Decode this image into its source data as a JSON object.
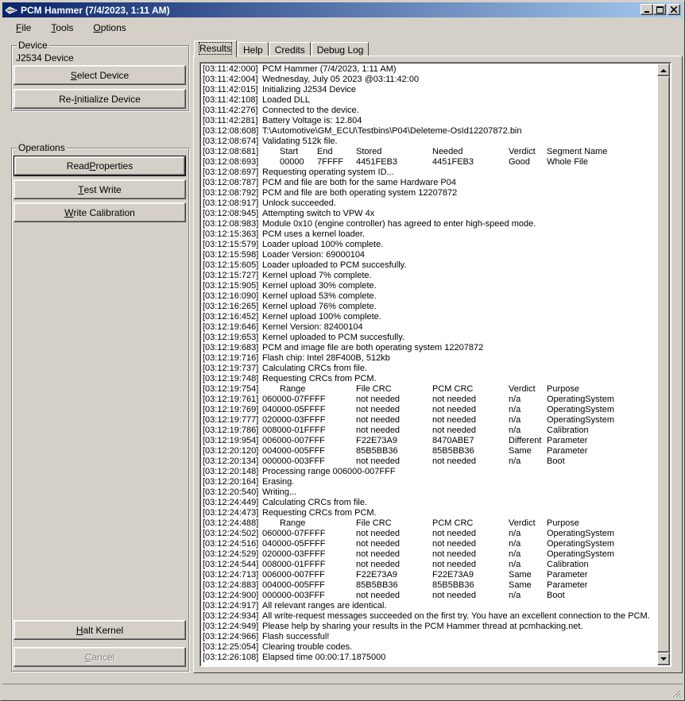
{
  "window": {
    "title": "PCM Hammer (7/4/2023, 1:11 AM)",
    "minimize": "0",
    "maximize": "1",
    "close": "r"
  },
  "menu": [
    {
      "mnemonic": "F",
      "rest": "ile"
    },
    {
      "mnemonic": "T",
      "rest": "ools"
    },
    {
      "mnemonic": "O",
      "rest": "ptions"
    }
  ],
  "device": {
    "group_label": "Device",
    "device_name": "J2534 Device",
    "select_btn": {
      "pre": "",
      "mn": "S",
      "post": "elect Device"
    },
    "reinit_btn": {
      "pre": "Re-",
      "mn": "I",
      "post": "nitialize Device"
    }
  },
  "operations": {
    "group_label": "Operations",
    "read_btn": {
      "pre": "Read ",
      "mn": "P",
      "post": "roperties"
    },
    "test_btn": {
      "pre": "",
      "mn": "T",
      "post": "est Write"
    },
    "write_btn": {
      "pre": "",
      "mn": "W",
      "post": "rite Calibration"
    },
    "halt_btn": {
      "pre": "",
      "mn": "H",
      "post": "alt Kernel"
    },
    "cancel_btn": {
      "pre": "",
      "mn": "C",
      "post": "ancel"
    }
  },
  "tabs": [
    "Results",
    "Help",
    "Credits",
    "Debug Log"
  ],
  "log": [
    [
      "[03:11:42:000]",
      "PCM Hammer (7/4/2023, 1:11 AM)"
    ],
    [
      "[03:11:42:004]",
      "Wednesday, July 05 2023 @03:11:42:00"
    ],
    [
      "[03:11:42:015]",
      "Initializing J2534 Device"
    ],
    [
      "[03:11:42:108]",
      "Loaded DLL"
    ],
    [
      "[03:11:42:276]",
      "Connected to the device."
    ],
    [
      "[03:11:42:281]",
      "Battery Voltage is: 12.804"
    ],
    [
      "[03:12:08:608]",
      "T:\\Automotive\\GM_ECU\\Testbins\\P04\\Deleteme-OsId12207872.bin"
    ],
    [
      "[03:12:08:674]",
      "Validating 512k file."
    ],
    [
      "[03:12:08:681]",
      "",
      "Start",
      "End",
      "Stored",
      "Needed",
      "Verdict",
      "Segment Name"
    ],
    [
      "[03:12:08:693]",
      "",
      "00000",
      "7FFFF",
      "4451FEB3",
      "4451FEB3",
      "Good",
      "Whole File"
    ],
    [
      "[03:12:08:697]",
      "Requesting operating system ID..."
    ],
    [
      "[03:12:08:787]",
      "PCM and file are both for the same Hardware P04"
    ],
    [
      "[03:12:08:792]",
      "PCM and file are both operating system 12207872"
    ],
    [
      "[03:12:08:917]",
      "Unlock succeeded."
    ],
    [
      "[03:12:08:945]",
      "Attempting switch to VPW 4x"
    ],
    [
      "[03:12:08:983]",
      "Module 0x10 (engine controller) has agreed to enter high-speed mode."
    ],
    [
      "[03:12:15:363]",
      "PCM uses a kernel loader."
    ],
    [
      "[03:12:15:579]",
      "Loader upload 100% complete."
    ],
    [
      "[03:12:15:598]",
      "Loader Version: 69000104"
    ],
    [
      "[03:12:15:605]",
      "Loader uploaded to PCM succesfully."
    ],
    [
      "[03:12:15:727]",
      "Kernel upload 7% complete."
    ],
    [
      "[03:12:15:905]",
      "Kernel upload 30% complete."
    ],
    [
      "[03:12:16:090]",
      "Kernel upload 53% complete."
    ],
    [
      "[03:12:16:265]",
      "Kernel upload 76% complete."
    ],
    [
      "[03:12:16:452]",
      "Kernel upload 100% complete."
    ],
    [
      "[03:12:19:646]",
      "Kernel Version: 82400104"
    ],
    [
      "[03:12:19:653]",
      "Kernel uploaded to PCM succesfully."
    ],
    [
      "[03:12:19:683]",
      "PCM and image file are both operating system 12207872"
    ],
    [
      "[03:12:19:716]",
      "Flash chip: Intel 28F400B, 512kb"
    ],
    [
      "[03:12:19:737]",
      "Calculating CRCs from file."
    ],
    [
      "[03:12:19:748]",
      "Requesting CRCs from PCM."
    ],
    [
      "[03:12:19:754]",
      "",
      "Range",
      "",
      "File CRC",
      "PCM CRC",
      "Verdict",
      "Purpose"
    ],
    [
      "[03:12:19:761]",
      "060000-07FFFF",
      "",
      "",
      "not needed",
      "not needed",
      "n/a",
      "OperatingSystem"
    ],
    [
      "[03:12:19:769]",
      "040000-05FFFF",
      "",
      "",
      "not needed",
      "not needed",
      "n/a",
      "OperatingSystem"
    ],
    [
      "[03:12:19:777]",
      "020000-03FFFF",
      "",
      "",
      "not needed",
      "not needed",
      "n/a",
      "OperatingSystem"
    ],
    [
      "[03:12:19:786]",
      "008000-01FFFF",
      "",
      "",
      "not needed",
      "not needed",
      "n/a",
      "Calibration"
    ],
    [
      "[03:12:19:954]",
      "006000-007FFF",
      "",
      "",
      "F22E73A9",
      "8470ABE7",
      "Different",
      "Parameter"
    ],
    [
      "[03:12:20:120]",
      "004000-005FFF",
      "",
      "",
      "85B5BB36",
      "85B5BB36",
      "Same",
      "Parameter"
    ],
    [
      "[03:12:20:134]",
      "000000-003FFF",
      "",
      "",
      "not needed",
      "not needed",
      "n/a",
      "Boot"
    ],
    [
      "[03:12:20:148]",
      "Processing range 006000-007FFF"
    ],
    [
      "[03:12:20:164]",
      "Erasing."
    ],
    [
      "[03:12:20:540]",
      "Writing..."
    ],
    [
      "[03:12:24:449]",
      "Calculating CRCs from file."
    ],
    [
      "[03:12:24:473]",
      "Requesting CRCs from PCM."
    ],
    [
      "[03:12:24:488]",
      "",
      "Range",
      "",
      "File CRC",
      "PCM CRC",
      "Verdict",
      "Purpose"
    ],
    [
      "[03:12:24:502]",
      "060000-07FFFF",
      "",
      "",
      "not needed",
      "not needed",
      "n/a",
      "OperatingSystem"
    ],
    [
      "[03:12:24:516]",
      "040000-05FFFF",
      "",
      "",
      "not needed",
      "not needed",
      "n/a",
      "OperatingSystem"
    ],
    [
      "[03:12:24:529]",
      "020000-03FFFF",
      "",
      "",
      "not needed",
      "not needed",
      "n/a",
      "OperatingSystem"
    ],
    [
      "[03:12:24:544]",
      "008000-01FFFF",
      "",
      "",
      "not needed",
      "not needed",
      "n/a",
      "Calibration"
    ],
    [
      "[03:12:24:713]",
      "006000-007FFF",
      "",
      "",
      "F22E73A9",
      "F22E73A9",
      "Same",
      "Parameter"
    ],
    [
      "[03:12:24:883]",
      "004000-005FFF",
      "",
      "",
      "85B5BB36",
      "85B5BB36",
      "Same",
      "Parameter"
    ],
    [
      "[03:12:24:900]",
      "000000-003FFF",
      "",
      "",
      "not needed",
      "not needed",
      "n/a",
      "Boot"
    ],
    [
      "[03:12:24:917]",
      "All relevant ranges are identical."
    ],
    [
      "[03:12:24:934]",
      "All write-request messages succeeded on the first try. You have an excellent connection to the PCM."
    ],
    [
      "[03:12:24:949]",
      "Please help by sharing your results in the PCM Hammer thread at pcmhacking.net."
    ],
    [
      "[03:12:24:966]",
      "Flash successful!"
    ],
    [
      "[03:12:25:054]",
      "Clearing trouble codes."
    ],
    [
      "[03:12:26:108]",
      "Elapsed time 00:00:17.1875000"
    ]
  ]
}
